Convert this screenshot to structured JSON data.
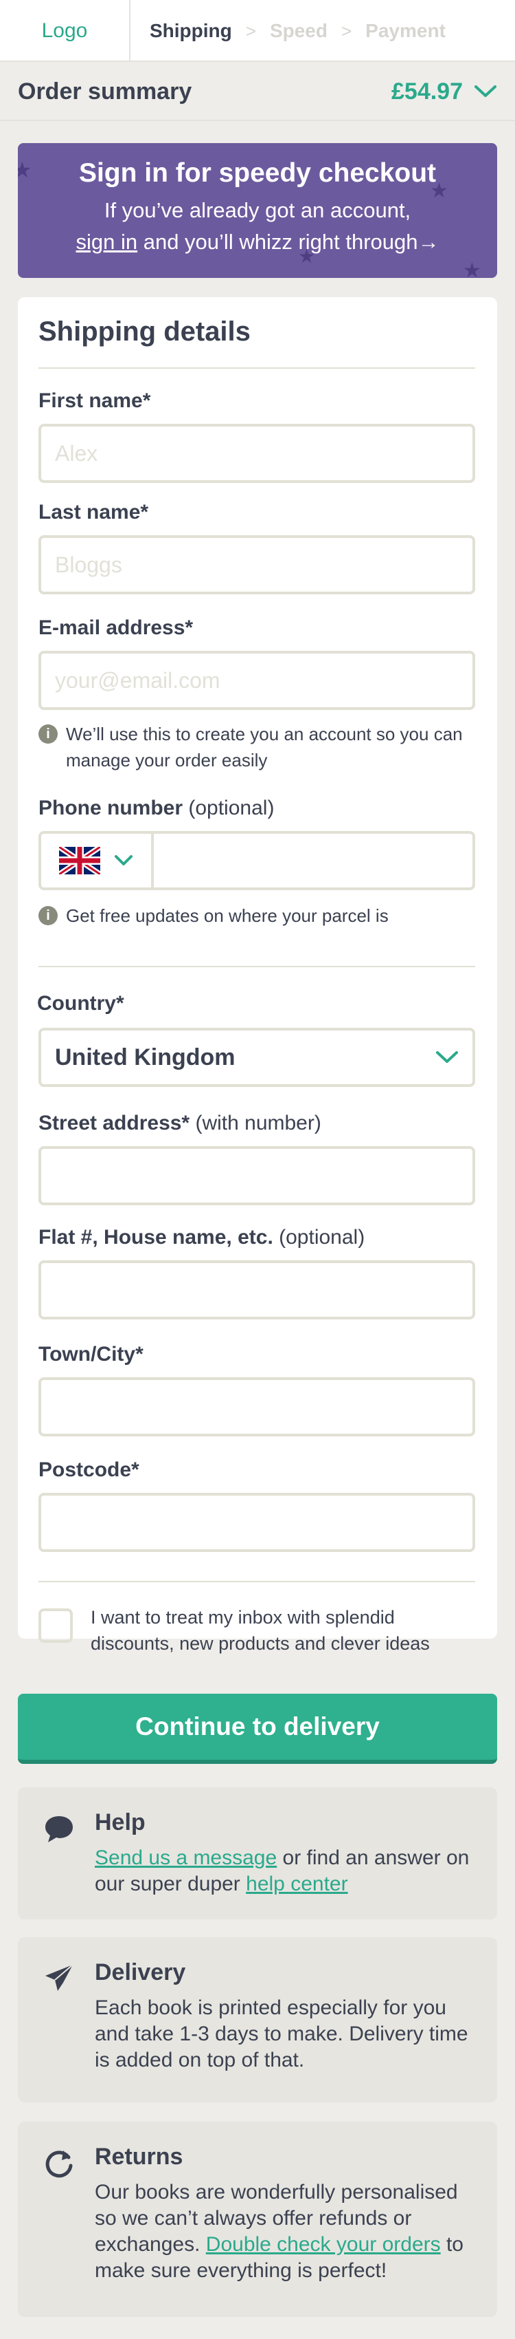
{
  "header": {
    "logo": "Logo",
    "steps": [
      "Shipping",
      "Speed",
      "Payment"
    ],
    "separator": ">"
  },
  "summary": {
    "title": "Order summary",
    "price": "£54.97"
  },
  "banner": {
    "title": "Sign in for speedy checkout",
    "line1": "If you’ve already got an account,",
    "link": "sign in",
    "line2_rest": " and you’ll whizz right through→"
  },
  "form": {
    "section_title": "Shipping details",
    "first_name": {
      "label": "First name*",
      "placeholder": "Alex"
    },
    "last_name": {
      "label": "Last name*",
      "placeholder": "Bloggs"
    },
    "email": {
      "label": "E-mail address*",
      "placeholder": "your@email.com",
      "hint": "We’ll use this to create you an account so you can manage your order easily"
    },
    "phone": {
      "label": "Phone number",
      "optional": "(optional)",
      "hint": "Get free updates on where your parcel is"
    },
    "country": {
      "label": "Country*",
      "value": "United Kingdom"
    },
    "street": {
      "label": "Street address*",
      "optional": "(with number)"
    },
    "flat": {
      "label": "Flat #, House name, etc.",
      "optional": "(optional)"
    },
    "town": {
      "label": "Town/City*"
    },
    "postcode": {
      "label": "Postcode*"
    },
    "newsletter": "I want to treat my inbox with splendid discounts, new products and clever ideas"
  },
  "cta": "Continue to delivery",
  "help": {
    "title": "Help",
    "link1": "Send us a message",
    "mid": " or find an answer on our super duper ",
    "link2": "help center"
  },
  "delivery": {
    "title": "Delivery",
    "body": "Each book is printed especially for you and take 1-3 days to make. Delivery time is added on top of that."
  },
  "returns": {
    "title": "Returns",
    "body_start": "Our books are wonderfully personalised so we can’t always offer refunds or exchanges. ",
    "link": "Double check your orders",
    "body_end": " to make sure everything is perfect!"
  },
  "colors": {
    "accent": "#2aa98c",
    "banner": "#6c5a9e",
    "text": "#3b4150",
    "background": "#eeede9"
  }
}
